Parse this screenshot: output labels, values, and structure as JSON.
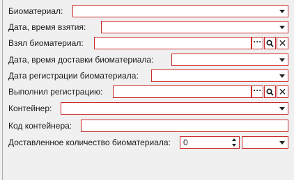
{
  "form": {
    "biomaterial_label": "Биоматериал:",
    "collection_datetime_label": "Дата, время взятия:",
    "taken_by_label": "Взял биоматериал:",
    "delivery_datetime_label": "Дата, время доставки биоматериала:",
    "registration_date_label": "Дата регистрации биоматериала:",
    "registered_by_label": "Выполнил регистрацию:",
    "container_label": "Контейнер:",
    "container_code_label": "Код контейнера:",
    "delivered_qty_label": "Доставленное количество биоматериала:",
    "delivered_qty_value": "0",
    "more_glyph": "···",
    "clear_glyph": "✕"
  },
  "icons": [
    "chevron-down-icon",
    "more-icon",
    "search-icon",
    "close-icon",
    "spin-up-icon",
    "spin-down-icon"
  ],
  "colors": {
    "field_border": "#cc2a2a",
    "background": "#f0f0f0"
  }
}
